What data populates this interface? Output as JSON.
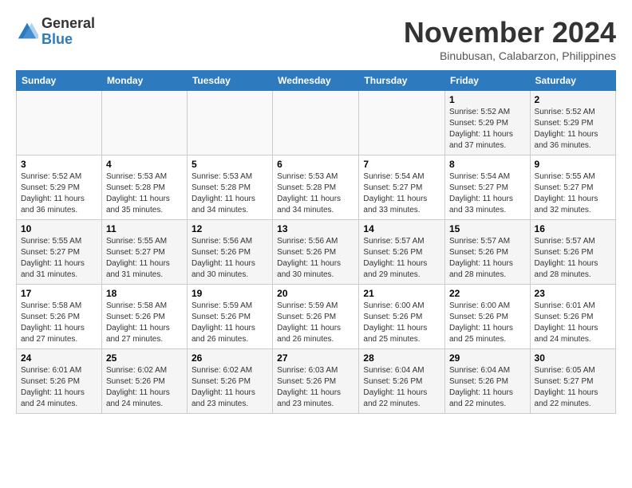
{
  "logo": {
    "general": "General",
    "blue": "Blue"
  },
  "header": {
    "month": "November 2024",
    "location": "Binubusan, Calabarzon, Philippines"
  },
  "weekdays": [
    "Sunday",
    "Monday",
    "Tuesday",
    "Wednesday",
    "Thursday",
    "Friday",
    "Saturday"
  ],
  "weeks": [
    [
      {
        "day": "",
        "info": ""
      },
      {
        "day": "",
        "info": ""
      },
      {
        "day": "",
        "info": ""
      },
      {
        "day": "",
        "info": ""
      },
      {
        "day": "",
        "info": ""
      },
      {
        "day": "1",
        "info": "Sunrise: 5:52 AM\nSunset: 5:29 PM\nDaylight: 11 hours and 37 minutes."
      },
      {
        "day": "2",
        "info": "Sunrise: 5:52 AM\nSunset: 5:29 PM\nDaylight: 11 hours and 36 minutes."
      }
    ],
    [
      {
        "day": "3",
        "info": "Sunrise: 5:52 AM\nSunset: 5:29 PM\nDaylight: 11 hours and 36 minutes."
      },
      {
        "day": "4",
        "info": "Sunrise: 5:53 AM\nSunset: 5:28 PM\nDaylight: 11 hours and 35 minutes."
      },
      {
        "day": "5",
        "info": "Sunrise: 5:53 AM\nSunset: 5:28 PM\nDaylight: 11 hours and 34 minutes."
      },
      {
        "day": "6",
        "info": "Sunrise: 5:53 AM\nSunset: 5:28 PM\nDaylight: 11 hours and 34 minutes."
      },
      {
        "day": "7",
        "info": "Sunrise: 5:54 AM\nSunset: 5:27 PM\nDaylight: 11 hours and 33 minutes."
      },
      {
        "day": "8",
        "info": "Sunrise: 5:54 AM\nSunset: 5:27 PM\nDaylight: 11 hours and 33 minutes."
      },
      {
        "day": "9",
        "info": "Sunrise: 5:55 AM\nSunset: 5:27 PM\nDaylight: 11 hours and 32 minutes."
      }
    ],
    [
      {
        "day": "10",
        "info": "Sunrise: 5:55 AM\nSunset: 5:27 PM\nDaylight: 11 hours and 31 minutes."
      },
      {
        "day": "11",
        "info": "Sunrise: 5:55 AM\nSunset: 5:27 PM\nDaylight: 11 hours and 31 minutes."
      },
      {
        "day": "12",
        "info": "Sunrise: 5:56 AM\nSunset: 5:26 PM\nDaylight: 11 hours and 30 minutes."
      },
      {
        "day": "13",
        "info": "Sunrise: 5:56 AM\nSunset: 5:26 PM\nDaylight: 11 hours and 30 minutes."
      },
      {
        "day": "14",
        "info": "Sunrise: 5:57 AM\nSunset: 5:26 PM\nDaylight: 11 hours and 29 minutes."
      },
      {
        "day": "15",
        "info": "Sunrise: 5:57 AM\nSunset: 5:26 PM\nDaylight: 11 hours and 28 minutes."
      },
      {
        "day": "16",
        "info": "Sunrise: 5:57 AM\nSunset: 5:26 PM\nDaylight: 11 hours and 28 minutes."
      }
    ],
    [
      {
        "day": "17",
        "info": "Sunrise: 5:58 AM\nSunset: 5:26 PM\nDaylight: 11 hours and 27 minutes."
      },
      {
        "day": "18",
        "info": "Sunrise: 5:58 AM\nSunset: 5:26 PM\nDaylight: 11 hours and 27 minutes."
      },
      {
        "day": "19",
        "info": "Sunrise: 5:59 AM\nSunset: 5:26 PM\nDaylight: 11 hours and 26 minutes."
      },
      {
        "day": "20",
        "info": "Sunrise: 5:59 AM\nSunset: 5:26 PM\nDaylight: 11 hours and 26 minutes."
      },
      {
        "day": "21",
        "info": "Sunrise: 6:00 AM\nSunset: 5:26 PM\nDaylight: 11 hours and 25 minutes."
      },
      {
        "day": "22",
        "info": "Sunrise: 6:00 AM\nSunset: 5:26 PM\nDaylight: 11 hours and 25 minutes."
      },
      {
        "day": "23",
        "info": "Sunrise: 6:01 AM\nSunset: 5:26 PM\nDaylight: 11 hours and 24 minutes."
      }
    ],
    [
      {
        "day": "24",
        "info": "Sunrise: 6:01 AM\nSunset: 5:26 PM\nDaylight: 11 hours and 24 minutes."
      },
      {
        "day": "25",
        "info": "Sunrise: 6:02 AM\nSunset: 5:26 PM\nDaylight: 11 hours and 24 minutes."
      },
      {
        "day": "26",
        "info": "Sunrise: 6:02 AM\nSunset: 5:26 PM\nDaylight: 11 hours and 23 minutes."
      },
      {
        "day": "27",
        "info": "Sunrise: 6:03 AM\nSunset: 5:26 PM\nDaylight: 11 hours and 23 minutes."
      },
      {
        "day": "28",
        "info": "Sunrise: 6:04 AM\nSunset: 5:26 PM\nDaylight: 11 hours and 22 minutes."
      },
      {
        "day": "29",
        "info": "Sunrise: 6:04 AM\nSunset: 5:26 PM\nDaylight: 11 hours and 22 minutes."
      },
      {
        "day": "30",
        "info": "Sunrise: 6:05 AM\nSunset: 5:27 PM\nDaylight: 11 hours and 22 minutes."
      }
    ]
  ]
}
